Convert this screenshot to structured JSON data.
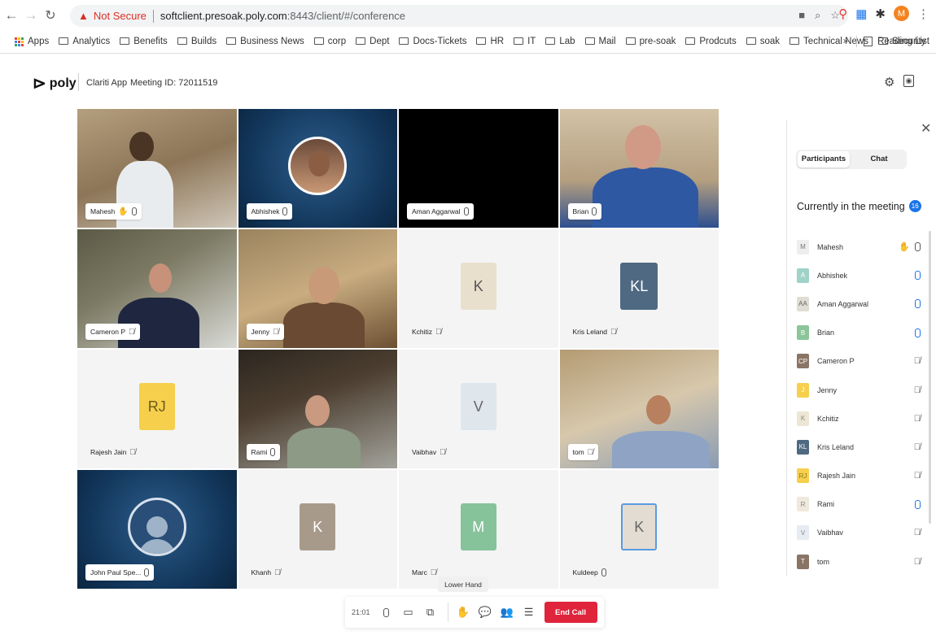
{
  "browser": {
    "not_secure_label": "Not Secure",
    "url_host": "softclient.presoak.poly.com",
    "url_path": ":8443/client/#/conference",
    "profile_initial": "M",
    "bookmarks": [
      "Apps",
      "Analytics",
      "Benefits",
      "Builds",
      "Business News",
      "corp",
      "Dept",
      "Docs-Tickets",
      "HR",
      "IT",
      "Lab",
      "Mail",
      "pre-soak",
      "Prodcuts",
      "soak",
      "Technical News",
      "Security"
    ],
    "reading_list_label": "Reading List",
    "overflow_label": "»"
  },
  "app": {
    "logo_text": "poly",
    "app_name": "Clariti App",
    "meeting_id": "Meeting ID: 72011519"
  },
  "tiles": [
    {
      "name": "Mahesh",
      "hand": true,
      "mic": "on"
    },
    {
      "name": "Abhishek",
      "mic": "on"
    },
    {
      "name": "Aman Aggarwal",
      "mic": "on"
    },
    {
      "name": "Brian",
      "mic": "on"
    },
    {
      "name": "Cameron P",
      "mic": "off"
    },
    {
      "name": "Jenny",
      "mic": "off"
    },
    {
      "name": "Kchitiz",
      "mic": "off",
      "initials": "K"
    },
    {
      "name": "Kris Leland",
      "mic": "off",
      "initials": "KL"
    },
    {
      "name": "Rajesh Jain",
      "mic": "off",
      "initials": "RJ"
    },
    {
      "name": "Rami",
      "mic": "on"
    },
    {
      "name": "Vaibhav",
      "mic": "off",
      "initials": "V"
    },
    {
      "name": "tom",
      "mic": "off"
    },
    {
      "name": "John Paul Spe...",
      "mic": "on"
    },
    {
      "name": "Khanh",
      "mic": "off",
      "initials": "K"
    },
    {
      "name": "Marc",
      "mic": "off",
      "initials": "M"
    },
    {
      "name": "Kuldeep",
      "mic": "on",
      "initials": "K"
    }
  ],
  "panel": {
    "tabs": [
      "Participants",
      "Chat"
    ],
    "title": "Currently in the meeting",
    "count": "16",
    "participants": [
      {
        "initials": "M",
        "name": "Mahesh",
        "status": "hand-muted"
      },
      {
        "initials": "A",
        "name": "Abhishek",
        "status": "mic-on"
      },
      {
        "initials": "AA",
        "name": "Aman Aggarwal",
        "status": "mic-on"
      },
      {
        "initials": "B",
        "name": "Brian",
        "status": "mic-on"
      },
      {
        "initials": "CP",
        "name": "Cameron P",
        "status": "muted"
      },
      {
        "initials": "J",
        "name": "Jenny",
        "status": "muted"
      },
      {
        "initials": "K",
        "name": "Kchitiz",
        "status": "muted"
      },
      {
        "initials": "KL",
        "name": "Kris Leland",
        "status": "muted"
      },
      {
        "initials": "RJ",
        "name": "Rajesh Jain",
        "status": "muted"
      },
      {
        "initials": "R",
        "name": "Rami",
        "status": "mic-on"
      },
      {
        "initials": "V",
        "name": "Vaibhav",
        "status": "muted"
      },
      {
        "initials": "T",
        "name": "tom",
        "status": "muted"
      }
    ]
  },
  "controls": {
    "timer": "21:01",
    "tooltip": "Lower Hand",
    "end_call_label": "End Call"
  },
  "colors": {
    "end_call": "#e0243c",
    "accent_blue": "#1a73e8",
    "avatar_k_beige": "#e8e0cc",
    "avatar_kl_slate": "#4f6983",
    "avatar_rj_yellow": "#f6d04d",
    "avatar_v_light": "#dfe6ec",
    "avatar_k_taupe": "#a89a8b",
    "avatar_m_green": "#86c39a",
    "avatar_kuldeep_highlight": "#5a9be0"
  }
}
